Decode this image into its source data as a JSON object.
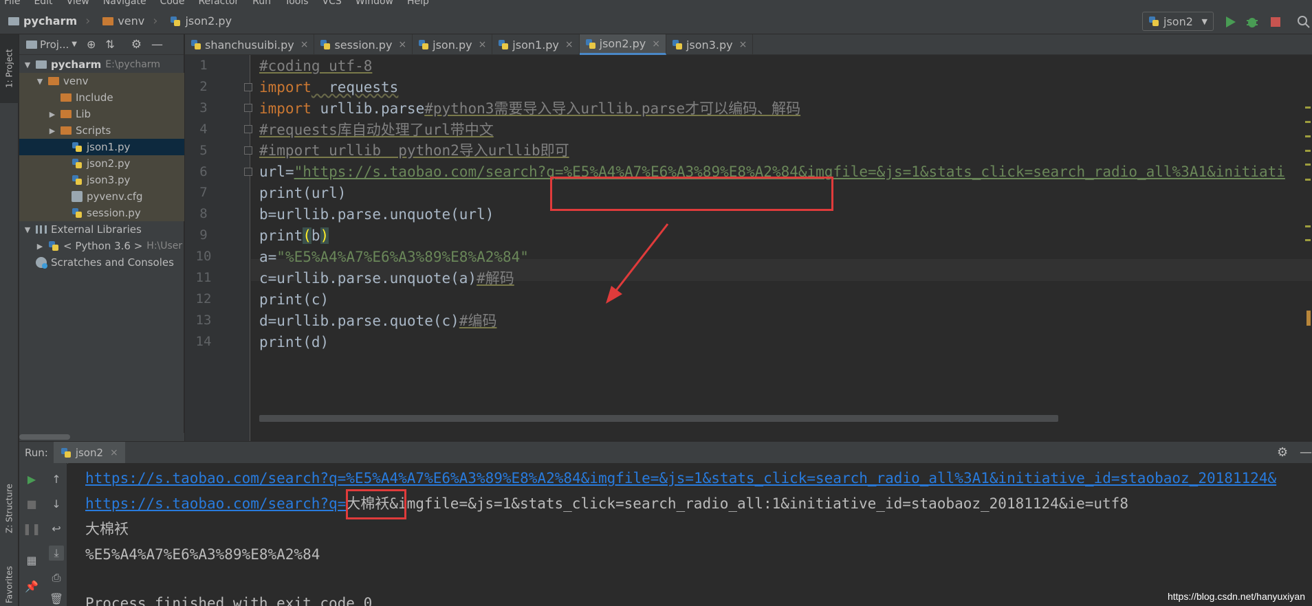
{
  "menubar": [
    "File",
    "Edit",
    "View",
    "Navigate",
    "Code",
    "Refactor",
    "Run",
    "Tools",
    "VCS",
    "Window",
    "Help"
  ],
  "breadcrumb": {
    "project": "pycharm",
    "folder": "venv",
    "file": "json2.py"
  },
  "run_config": {
    "name": "json2"
  },
  "left_tabs": {
    "project": "1: Project",
    "structure": "Z: Structure",
    "favorites": "Favorites"
  },
  "project_panel": {
    "title": "Proj...",
    "root": {
      "name": "pycharm",
      "path": "E:\\pycharm"
    },
    "venv": "venv",
    "venv_children": [
      "Include",
      "Lib",
      "Scripts"
    ],
    "files": [
      "json1.py",
      "json2.py",
      "json3.py",
      "pyvenv.cfg",
      "session.py"
    ],
    "selected_file": "json1.py",
    "external_libraries": "External Libraries",
    "python_sdk": {
      "name": "< Python 3.6 >",
      "path": "H:\\User"
    },
    "scratches": "Scratches and Consoles"
  },
  "tabs": [
    {
      "label": "shanchusuibi.py",
      "active": false
    },
    {
      "label": "session.py",
      "active": false
    },
    {
      "label": "json.py",
      "active": false
    },
    {
      "label": "json1.py",
      "active": false
    },
    {
      "label": "json2.py",
      "active": true
    },
    {
      "label": "json3.py",
      "active": false
    }
  ],
  "code": {
    "line_numbers": [
      "1",
      "2",
      "3",
      "4",
      "5",
      "6",
      "7",
      "8",
      "9",
      "10",
      "11",
      "12",
      "13",
      "14"
    ],
    "l1": "#coding utf-8",
    "l2_kw": "import",
    "l2_rest": "  requests",
    "l3_kw": "import",
    "l3_mod": " urllib.parse",
    "l3_cm": "#python3需要导入导入urllib.parse才可以编码、解码",
    "l4": "#requests库自动处理了url带中文",
    "l5": "#import urllib  python2导入urllib即可",
    "l6_pre": "url=",
    "l6_str": "\"https://s.taobao.com/search?q=%E5%A4%A7%E6%A3%89%E8%A2%84&imgfile=&js=1&stats_click=search_radio_all%3A1&initiati",
    "l7": "print(url)",
    "l8": "b=urllib.parse.unquote(url)",
    "l9_a": "print",
    "l9_b": "(",
    "l9_c": "b",
    "l9_d": ")",
    "l10_pre": "a=",
    "l10_str": "\"%E5%A4%A7%E6%A3%89%E8%A2%84\"",
    "l11_pre": "c=urllib.parse.unquote(a)",
    "l11_cm": "#解码",
    "l12": "print(c)",
    "l13_pre": "d=urllib.parse.quote(c)",
    "l13_cm": "#编码",
    "l14": "print(d)"
  },
  "run_panel": {
    "label": "Run:",
    "tab": "json2",
    "output": {
      "line1_link": "https://s.taobao.com/search?q=%E5%A4%A7%E6%A3%89%E8%A2%84&imgfile=&js=1&stats_click=search_radio_all%3A1&initiative_id=staobaoz_20181124&",
      "line2_link": "https://s.taobao.com/search?q=",
      "line2_rest": "大棉袄&imgfile=&js=1&stats_click=search_radio_all:1&initiative_id=staobaoz_20181124&ie=utf8",
      "line3": "大棉袄",
      "line4": "%E5%A4%A7%E6%A3%89%E8%A2%84",
      "line5": "Process finished with exit code 0"
    }
  },
  "watermark": "https://blog.csdn.net/hanyuxiyan",
  "colors": {
    "annotation_red": "#e03b3b",
    "link_blue": "#287bde",
    "keyword": "#cc7832",
    "string": "#6a8759",
    "comment": "#808080"
  }
}
